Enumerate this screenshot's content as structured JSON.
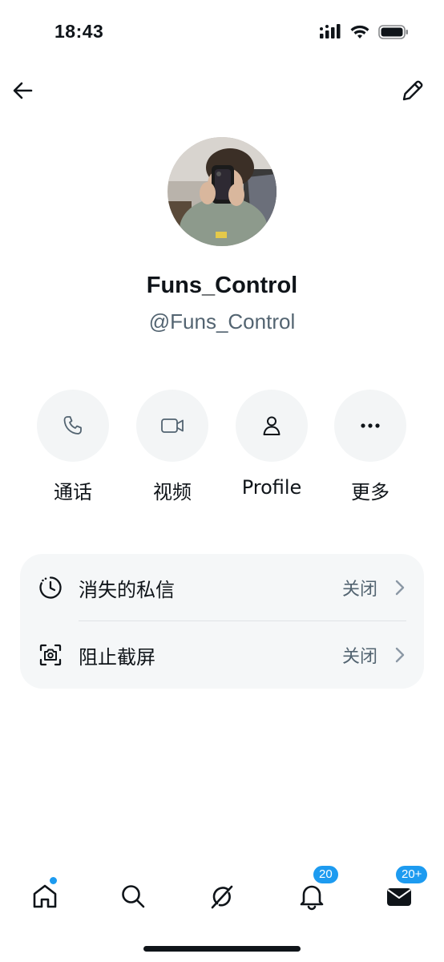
{
  "status_bar": {
    "time": "18:43"
  },
  "nav": {
    "back_icon": "arrow-left-icon",
    "edit_icon": "pencil-icon"
  },
  "profile": {
    "display_name": "Funs_Control",
    "handle": "@Funs_Control"
  },
  "actions": [
    {
      "label": "通话",
      "icon": "phone-icon"
    },
    {
      "label": "视频",
      "icon": "video-icon"
    },
    {
      "label": "Profile",
      "icon": "person-icon"
    },
    {
      "label": "更多",
      "icon": "more-icon"
    }
  ],
  "settings": [
    {
      "label": "消失的私信",
      "value": "关闭",
      "icon": "timer-icon"
    },
    {
      "label": "阻止截屏",
      "value": "关闭",
      "icon": "screenshot-icon"
    }
  ],
  "tabbar": {
    "notifications_badge": "20",
    "messages_badge": "20+"
  },
  "colors": {
    "accent": "#1d9bf0",
    "text_primary": "#0f1419",
    "text_secondary": "#536471",
    "button_bg": "#f3f5f6",
    "card_bg": "#f5f7f8"
  }
}
